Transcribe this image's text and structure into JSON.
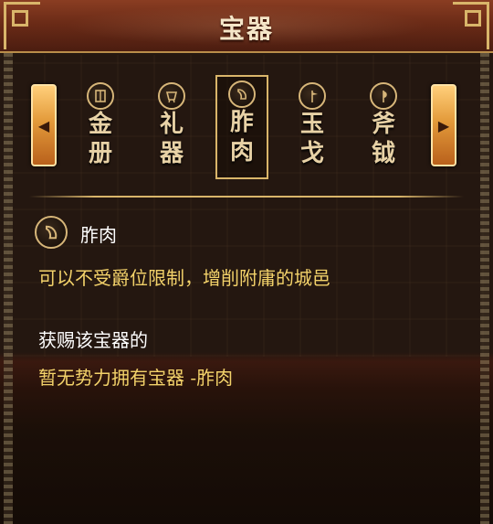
{
  "title": "宝器",
  "nav": {
    "prev_icon": "chevron-left-icon",
    "next_icon": "chevron-right-icon"
  },
  "items": [
    {
      "label": "金\n册",
      "icon": "book-icon"
    },
    {
      "label": "礼\n器",
      "icon": "vessel-icon"
    },
    {
      "label": "胙\n肉",
      "icon": "meat-icon"
    },
    {
      "label": "玉\n戈",
      "icon": "dagger-axe-icon"
    },
    {
      "label": "斧\n钺",
      "icon": "axe-icon"
    }
  ],
  "selected_index": 2,
  "detail": {
    "name": "胙肉",
    "description": "可以不受爵位限制，增削附庸的城邑",
    "holders_title": "获赐该宝器的",
    "holders_text": "暂无势力拥有宝器 -胙肉"
  },
  "colors": {
    "gold": "#d9b56a",
    "text_yellow": "#f3d26a",
    "title_bar": "#6b2b17"
  }
}
